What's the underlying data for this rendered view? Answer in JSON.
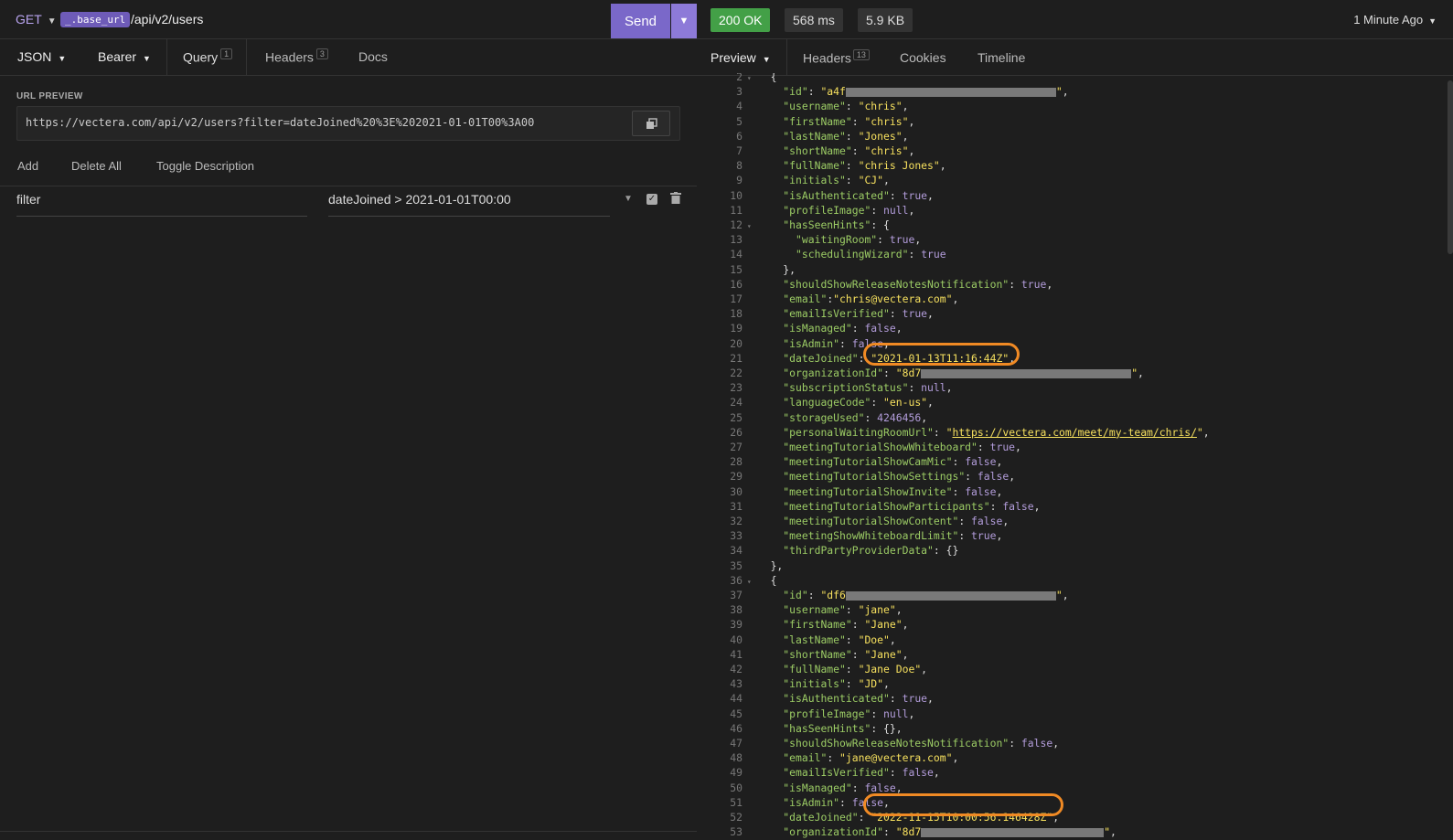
{
  "request": {
    "method": "GET",
    "base_url_var": "_.base_url",
    "path": "/api/v2/users",
    "send_label": "Send"
  },
  "request_tabs": {
    "body_type": "JSON",
    "auth_type": "Bearer",
    "query_label": "Query",
    "query_count": "1",
    "headers_label": "Headers",
    "headers_count": "3",
    "docs_label": "Docs"
  },
  "url_preview": {
    "label": "URL PREVIEW",
    "value": "https://vectera.com/api/v2/users?filter=dateJoined%20%3E%202021-01-01T00%3A00"
  },
  "param_actions": {
    "add": "Add",
    "delete_all": "Delete All",
    "toggle_description": "Toggle Description"
  },
  "params": [
    {
      "name": "filter",
      "value": "dateJoined > 2021-01-01T00:00"
    }
  ],
  "response": {
    "status": "200 OK",
    "time": "568 ms",
    "size": "5.9 KB",
    "ago": "1 Minute Ago",
    "colors": {
      "ok": "#43a047",
      "accent": "#7a68c9",
      "highlight": "#f08a24"
    }
  },
  "response_tabs": {
    "preview": "Preview",
    "headers": "Headers",
    "headers_count": "13",
    "cookies": "Cookies",
    "timeline": "Timeline"
  },
  "code_lines": [
    {
      "n": "2",
      "fold": true,
      "t": [
        [
          "p",
          "{"
        ]
      ],
      "ind": 0
    },
    {
      "n": "3",
      "t": [
        [
          "k",
          "\"id\""
        ],
        [
          "p",
          ": "
        ],
        [
          "s",
          "\"a4f"
        ],
        [
          "r",
          "230"
        ],
        [
          "s",
          "\""
        ],
        [
          "p",
          ","
        ]
      ],
      "ind": 1
    },
    {
      "n": "4",
      "t": [
        [
          "k",
          "\"username\""
        ],
        [
          "p",
          ": "
        ],
        [
          "s",
          "\"chris\""
        ],
        [
          "p",
          ","
        ]
      ],
      "ind": 1
    },
    {
      "n": "5",
      "t": [
        [
          "k",
          "\"firstName\""
        ],
        [
          "p",
          ": "
        ],
        [
          "s",
          "\"chris\""
        ],
        [
          "p",
          ","
        ]
      ],
      "ind": 1
    },
    {
      "n": "6",
      "t": [
        [
          "k",
          "\"lastName\""
        ],
        [
          "p",
          ": "
        ],
        [
          "s",
          "\"Jones\""
        ],
        [
          "p",
          ","
        ]
      ],
      "ind": 1
    },
    {
      "n": "7",
      "t": [
        [
          "k",
          "\"shortName\""
        ],
        [
          "p",
          ": "
        ],
        [
          "s",
          "\"chris\""
        ],
        [
          "p",
          ","
        ]
      ],
      "ind": 1
    },
    {
      "n": "8",
      "t": [
        [
          "k",
          "\"fullName\""
        ],
        [
          "p",
          ": "
        ],
        [
          "s",
          "\"chris Jones\""
        ],
        [
          "p",
          ","
        ]
      ],
      "ind": 1
    },
    {
      "n": "9",
      "t": [
        [
          "k",
          "\"initials\""
        ],
        [
          "p",
          ": "
        ],
        [
          "s",
          "\"CJ\""
        ],
        [
          "p",
          ","
        ]
      ],
      "ind": 1
    },
    {
      "n": "10",
      "t": [
        [
          "k",
          "\"isAuthenticated\""
        ],
        [
          "p",
          ": "
        ],
        [
          "b",
          "true"
        ],
        [
          "p",
          ","
        ]
      ],
      "ind": 1
    },
    {
      "n": "11",
      "t": [
        [
          "k",
          "\"profileImage\""
        ],
        [
          "p",
          ": "
        ],
        [
          "b",
          "null"
        ],
        [
          "p",
          ","
        ]
      ],
      "ind": 1
    },
    {
      "n": "12",
      "fold": true,
      "t": [
        [
          "k",
          "\"hasSeenHints\""
        ],
        [
          "p",
          ": {"
        ]
      ],
      "ind": 1
    },
    {
      "n": "13",
      "t": [
        [
          "k",
          "\"waitingRoom\""
        ],
        [
          "p",
          ": "
        ],
        [
          "b",
          "true"
        ],
        [
          "p",
          ","
        ]
      ],
      "ind": 2
    },
    {
      "n": "14",
      "t": [
        [
          "k",
          "\"schedulingWizard\""
        ],
        [
          "p",
          ": "
        ],
        [
          "b",
          "true"
        ]
      ],
      "ind": 2
    },
    {
      "n": "15",
      "t": [
        [
          "p",
          "},"
        ]
      ],
      "ind": 1
    },
    {
      "n": "16",
      "t": [
        [
          "k",
          "\"shouldShowReleaseNotesNotification\""
        ],
        [
          "p",
          ": "
        ],
        [
          "b",
          "true"
        ],
        [
          "p",
          ","
        ]
      ],
      "ind": 1
    },
    {
      "n": "17",
      "t": [
        [
          "k",
          "\"email\""
        ],
        [
          "p",
          ":"
        ],
        [
          "s",
          "\"chris@vectera.com\""
        ],
        [
          "p",
          ","
        ]
      ],
      "ind": 1
    },
    {
      "n": "18",
      "t": [
        [
          "k",
          "\"emailIsVerified\""
        ],
        [
          "p",
          ": "
        ],
        [
          "b",
          "true"
        ],
        [
          "p",
          ","
        ]
      ],
      "ind": 1
    },
    {
      "n": "19",
      "t": [
        [
          "k",
          "\"isManaged\""
        ],
        [
          "p",
          ": "
        ],
        [
          "b",
          "false"
        ],
        [
          "p",
          ","
        ]
      ],
      "ind": 1
    },
    {
      "n": "20",
      "t": [
        [
          "k",
          "\"isAdmin\""
        ],
        [
          "p",
          ": "
        ],
        [
          "b",
          "false"
        ],
        [
          "p",
          ","
        ]
      ],
      "ind": 1
    },
    {
      "n": "21",
      "t": [
        [
          "k",
          "\"dateJoined\""
        ],
        [
          "p",
          ": "
        ],
        [
          "s",
          "\"2021-01-13T11:16:44Z\""
        ],
        [
          "p",
          ","
        ]
      ],
      "ind": 1
    },
    {
      "n": "22",
      "t": [
        [
          "k",
          "\"organizationId\""
        ],
        [
          "p",
          ": "
        ],
        [
          "s",
          "\"8d7"
        ],
        [
          "r",
          "230"
        ],
        [
          "s",
          "\""
        ],
        [
          "p",
          ","
        ]
      ],
      "ind": 1
    },
    {
      "n": "23",
      "t": [
        [
          "k",
          "\"subscriptionStatus\""
        ],
        [
          "p",
          ": "
        ],
        [
          "b",
          "null"
        ],
        [
          "p",
          ","
        ]
      ],
      "ind": 1
    },
    {
      "n": "24",
      "t": [
        [
          "k",
          "\"languageCode\""
        ],
        [
          "p",
          ": "
        ],
        [
          "s",
          "\"en-us\""
        ],
        [
          "p",
          ","
        ]
      ],
      "ind": 1
    },
    {
      "n": "25",
      "t": [
        [
          "k",
          "\"storageUsed\""
        ],
        [
          "p",
          ": "
        ],
        [
          "b",
          "4246456"
        ],
        [
          "p",
          ","
        ]
      ],
      "ind": 1
    },
    {
      "n": "26",
      "t": [
        [
          "k",
          "\"personalWaitingRoomUrl\""
        ],
        [
          "p",
          ": "
        ],
        [
          "s",
          "\""
        ],
        [
          "u",
          "https://vectera.com/meet/my-team/chris/"
        ],
        [
          "s",
          "\""
        ],
        [
          "p",
          ","
        ]
      ],
      "ind": 1
    },
    {
      "n": "27",
      "t": [
        [
          "k",
          "\"meetingTutorialShowWhiteboard\""
        ],
        [
          "p",
          ": "
        ],
        [
          "b",
          "true"
        ],
        [
          "p",
          ","
        ]
      ],
      "ind": 1
    },
    {
      "n": "28",
      "t": [
        [
          "k",
          "\"meetingTutorialShowCamMic\""
        ],
        [
          "p",
          ": "
        ],
        [
          "b",
          "false"
        ],
        [
          "p",
          ","
        ]
      ],
      "ind": 1
    },
    {
      "n": "29",
      "t": [
        [
          "k",
          "\"meetingTutorialShowSettings\""
        ],
        [
          "p",
          ": "
        ],
        [
          "b",
          "false"
        ],
        [
          "p",
          ","
        ]
      ],
      "ind": 1
    },
    {
      "n": "30",
      "t": [
        [
          "k",
          "\"meetingTutorialShowInvite\""
        ],
        [
          "p",
          ": "
        ],
        [
          "b",
          "false"
        ],
        [
          "p",
          ","
        ]
      ],
      "ind": 1
    },
    {
      "n": "31",
      "t": [
        [
          "k",
          "\"meetingTutorialShowParticipants\""
        ],
        [
          "p",
          ": "
        ],
        [
          "b",
          "false"
        ],
        [
          "p",
          ","
        ]
      ],
      "ind": 1
    },
    {
      "n": "32",
      "t": [
        [
          "k",
          "\"meetingTutorialShowContent\""
        ],
        [
          "p",
          ": "
        ],
        [
          "b",
          "false"
        ],
        [
          "p",
          ","
        ]
      ],
      "ind": 1
    },
    {
      "n": "33",
      "t": [
        [
          "k",
          "\"meetingShowWhiteboardLimit\""
        ],
        [
          "p",
          ": "
        ],
        [
          "b",
          "true"
        ],
        [
          "p",
          ","
        ]
      ],
      "ind": 1
    },
    {
      "n": "34",
      "t": [
        [
          "k",
          "\"thirdPartyProviderData\""
        ],
        [
          "p",
          ": {}"
        ]
      ],
      "ind": 1
    },
    {
      "n": "35",
      "t": [
        [
          "p",
          "},"
        ]
      ],
      "ind": 0
    },
    {
      "n": "36",
      "fold": true,
      "t": [
        [
          "p",
          "{"
        ]
      ],
      "ind": 0
    },
    {
      "n": "37",
      "t": [
        [
          "k",
          "\"id\""
        ],
        [
          "p",
          ": "
        ],
        [
          "s",
          "\"df6"
        ],
        [
          "r",
          "230"
        ],
        [
          "s",
          "\""
        ],
        [
          "p",
          ","
        ]
      ],
      "ind": 1
    },
    {
      "n": "38",
      "t": [
        [
          "k",
          "\"username\""
        ],
        [
          "p",
          ": "
        ],
        [
          "s",
          "\"jane\""
        ],
        [
          "p",
          ","
        ]
      ],
      "ind": 1
    },
    {
      "n": "39",
      "t": [
        [
          "k",
          "\"firstName\""
        ],
        [
          "p",
          ": "
        ],
        [
          "s",
          "\"Jane\""
        ],
        [
          "p",
          ","
        ]
      ],
      "ind": 1
    },
    {
      "n": "40",
      "t": [
        [
          "k",
          "\"lastName\""
        ],
        [
          "p",
          ": "
        ],
        [
          "s",
          "\"Doe\""
        ],
        [
          "p",
          ","
        ]
      ],
      "ind": 1
    },
    {
      "n": "41",
      "t": [
        [
          "k",
          "\"shortName\""
        ],
        [
          "p",
          ": "
        ],
        [
          "s",
          "\"Jane\""
        ],
        [
          "p",
          ","
        ]
      ],
      "ind": 1
    },
    {
      "n": "42",
      "t": [
        [
          "k",
          "\"fullName\""
        ],
        [
          "p",
          ": "
        ],
        [
          "s",
          "\"Jane Doe\""
        ],
        [
          "p",
          ","
        ]
      ],
      "ind": 1
    },
    {
      "n": "43",
      "t": [
        [
          "k",
          "\"initials\""
        ],
        [
          "p",
          ": "
        ],
        [
          "s",
          "\"JD\""
        ],
        [
          "p",
          ","
        ]
      ],
      "ind": 1
    },
    {
      "n": "44",
      "t": [
        [
          "k",
          "\"isAuthenticated\""
        ],
        [
          "p",
          ": "
        ],
        [
          "b",
          "true"
        ],
        [
          "p",
          ","
        ]
      ],
      "ind": 1
    },
    {
      "n": "45",
      "t": [
        [
          "k",
          "\"profileImage\""
        ],
        [
          "p",
          ": "
        ],
        [
          "b",
          "null"
        ],
        [
          "p",
          ","
        ]
      ],
      "ind": 1
    },
    {
      "n": "46",
      "t": [
        [
          "k",
          "\"hasSeenHints\""
        ],
        [
          "p",
          ": {},"
        ]
      ],
      "ind": 1
    },
    {
      "n": "47",
      "t": [
        [
          "k",
          "\"shouldShowReleaseNotesNotification\""
        ],
        [
          "p",
          ": "
        ],
        [
          "b",
          "false"
        ],
        [
          "p",
          ","
        ]
      ],
      "ind": 1
    },
    {
      "n": "48",
      "t": [
        [
          "k",
          "\"email\""
        ],
        [
          "p",
          ": "
        ],
        [
          "s",
          "\"jane@vectera.com\""
        ],
        [
          "p",
          ","
        ]
      ],
      "ind": 1
    },
    {
      "n": "49",
      "t": [
        [
          "k",
          "\"emailIsVerified\""
        ],
        [
          "p",
          ": "
        ],
        [
          "b",
          "false"
        ],
        [
          "p",
          ","
        ]
      ],
      "ind": 1
    },
    {
      "n": "50",
      "t": [
        [
          "k",
          "\"isManaged\""
        ],
        [
          "p",
          ": "
        ],
        [
          "b",
          "false"
        ],
        [
          "p",
          ","
        ]
      ],
      "ind": 1
    },
    {
      "n": "51",
      "t": [
        [
          "k",
          "\"isAdmin\""
        ],
        [
          "p",
          ": "
        ],
        [
          "b",
          "false"
        ],
        [
          "p",
          ","
        ]
      ],
      "ind": 1
    },
    {
      "n": "52",
      "t": [
        [
          "k",
          "\"dateJoined\""
        ],
        [
          "p",
          ": "
        ],
        [
          "s",
          "\"2022-11-15T10:00:56.146428Z\""
        ],
        [
          "p",
          ","
        ]
      ],
      "ind": 1
    },
    {
      "n": "53",
      "t": [
        [
          "k",
          "\"organizationId\""
        ],
        [
          "p",
          ": "
        ],
        [
          "s",
          "\"8d7"
        ],
        [
          "r",
          "200"
        ],
        [
          "s",
          "\""
        ],
        [
          "p",
          ","
        ]
      ],
      "ind": 1
    }
  ]
}
